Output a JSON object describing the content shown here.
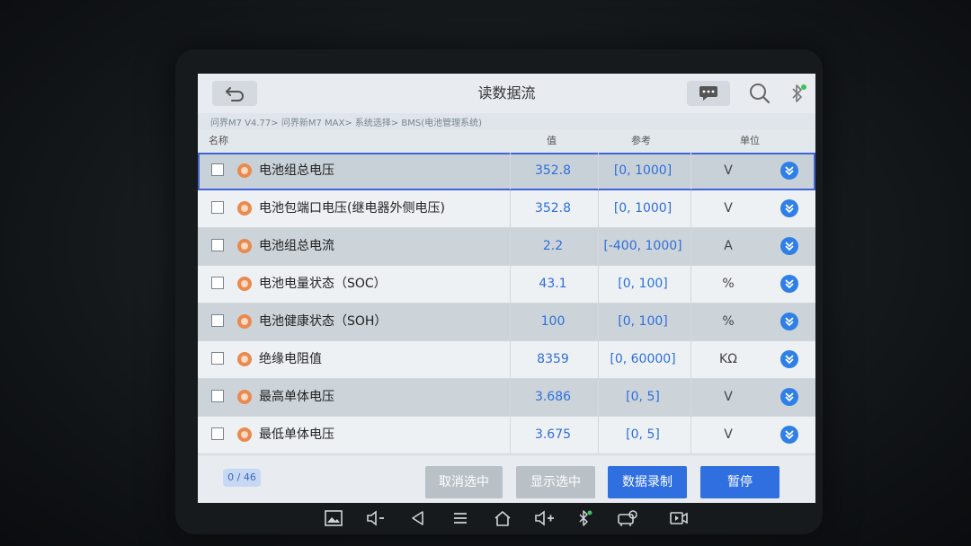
{
  "header": {
    "title": "读数据流"
  },
  "breadcrumb": "问界M7 V4.77> 问界新M7 MAX> 系统选择> BMS(电池管理系统)",
  "table": {
    "columns": {
      "name": "名称",
      "value": "值",
      "reference": "参考",
      "unit": "单位"
    },
    "rows": [
      {
        "name": "电池组总电压",
        "value": "352.8",
        "reference": "[0, 1000]",
        "unit": "V"
      },
      {
        "name": "电池包端口电压(继电器外侧电压)",
        "value": "352.8",
        "reference": "[0, 1000]",
        "unit": "V"
      },
      {
        "name": "电池组总电流",
        "value": "2.2",
        "reference": "[-400, 1000]",
        "unit": "A"
      },
      {
        "name": "电池电量状态（SOC）",
        "value": "43.1",
        "reference": "[0, 100]",
        "unit": "%"
      },
      {
        "name": "电池健康状态（SOH）",
        "value": "100",
        "reference": "[0, 100]",
        "unit": "%"
      },
      {
        "name": "绝缘电阻值",
        "value": "8359",
        "reference": "[0, 60000]",
        "unit": "KΩ"
      },
      {
        "name": "最高单体电压",
        "value": "3.686",
        "reference": "[0, 5]",
        "unit": "V"
      },
      {
        "name": "最低单体电压",
        "value": "3.675",
        "reference": "[0, 5]",
        "unit": "V"
      }
    ]
  },
  "footer": {
    "counter": "0 / 46",
    "deselect_label": "取消选中",
    "show_selected_label": "显示选中",
    "record_label": "数据录制",
    "pause_label": "暂停"
  },
  "colors": {
    "accent": "#2f6fe0",
    "value_text": "#2f6fd8",
    "status_dot": "#e98a4f"
  },
  "icons": [
    "back-icon",
    "chat-icon",
    "search-icon",
    "bluetooth-icon",
    "expand-icon",
    "gallery-icon",
    "volume-down-icon",
    "nav-back-icon",
    "menu-icon",
    "home-icon",
    "volume-up-icon",
    "vci-icon",
    "screen-record-icon"
  ]
}
